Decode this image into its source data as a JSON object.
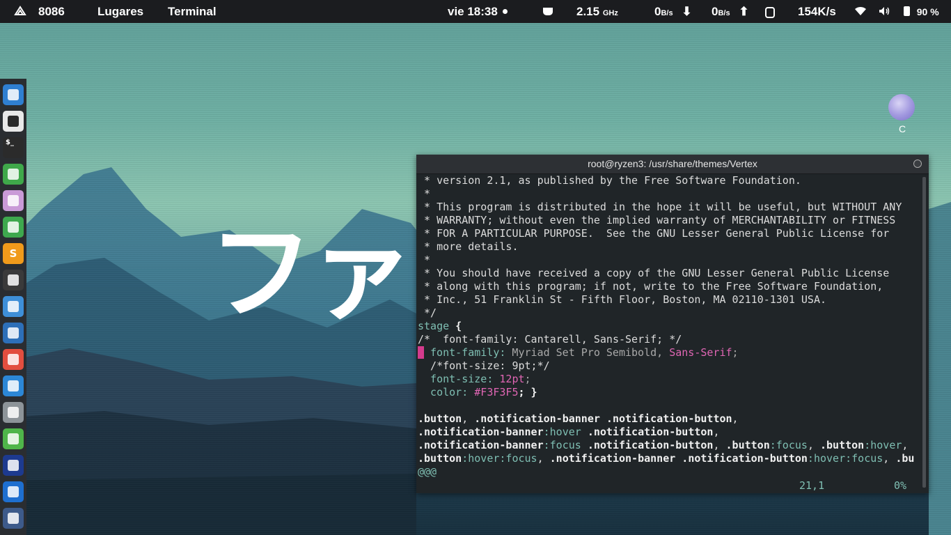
{
  "panel": {
    "activities_label": "8086",
    "places_label": "Lugares",
    "app_label": "Terminal",
    "clock": "vie 18:38",
    "cpu_freq_value": "2.15",
    "cpu_freq_unit": "GHz",
    "net_down_value": "0",
    "net_down_unit": "B/s",
    "net_up_value": "0",
    "net_up_unit": "B/s",
    "net_speed": "154K/s",
    "battery_percent": "90 %"
  },
  "dock": {
    "items": [
      {
        "name": "text-editor",
        "icon": "document-lines-icon",
        "color": "#2f7fd1"
      },
      {
        "name": "music-player",
        "icon": "music-note-icon",
        "color": "#e8e8e8"
      },
      {
        "name": "terminal",
        "icon": "terminal-icon",
        "glyph": "$_",
        "color": "#2b2b2b"
      },
      {
        "name": "chrome",
        "icon": "chrome-icon",
        "color": "#3fa84a"
      },
      {
        "name": "files",
        "icon": "folder-icon",
        "color": "#c99ad7"
      },
      {
        "name": "system-monitor",
        "icon": "monitor-icon",
        "color": "#3ea84e"
      },
      {
        "name": "sublime-text",
        "icon": "sublime-icon",
        "glyph": "S",
        "color": "#f09a1b"
      },
      {
        "name": "calculator",
        "icon": "calculator-icon",
        "color": "#3a3a3a"
      },
      {
        "name": "screenshot",
        "icon": "camera-icon",
        "color": "#3e8fd8"
      },
      {
        "name": "gnome-foot",
        "icon": "paw-icon",
        "color": "#2d6fb8"
      },
      {
        "name": "update-manager",
        "icon": "updown-arrows-icon",
        "color": "#e24e3f"
      },
      {
        "name": "activity-monitor",
        "icon": "waveform-icon",
        "color": "#2c87d6"
      },
      {
        "name": "disks",
        "icon": "database-icon",
        "color": "#8d9499"
      },
      {
        "name": "drawing",
        "icon": "brush-icon",
        "color": "#4fb54a"
      },
      {
        "name": "vlc",
        "icon": "cone-icon",
        "color": "#1d3a8f"
      },
      {
        "name": "teamviewer",
        "icon": "teamviewer-icon",
        "color": "#1e6fd0"
      },
      {
        "name": "vector-app",
        "icon": "pen-nib-icon",
        "color": "#3d5a8a"
      }
    ]
  },
  "desktop_icon": {
    "label": "C",
    "icon": "sphere-icon"
  },
  "wallpaper_text": "ファン",
  "terminal": {
    "title": "root@ryzen3: /usr/share/themes/Vertex",
    "status_position": "21,1",
    "status_percent": "0%",
    "lines": {
      "l1": " * version 2.1, as published by the Free Software Foundation.",
      "l2": " *",
      "l3": " * This program is distributed in the hope it will be useful, but WITHOUT ANY",
      "l4": " * WARRANTY; without even the implied warranty of MERCHANTABILITY or FITNESS",
      "l5": " * FOR A PARTICULAR PURPOSE.  See the GNU Lesser General Public License for",
      "l6": " * more details.",
      "l7": " *",
      "l8": " * You should have received a copy of the GNU Lesser General Public License",
      "l9": " * along with this program; if not, write to the Free Software Foundation,",
      "l10": " * Inc., 51 Franklin St - Fifth Floor, Boston, MA 02110-1301 USA.",
      "l11": " */",
      "l12_sel": "stage",
      "l12_brace": " {",
      "l13": "/*  font-family: Cantarell, Sans-Serif; */",
      "l14_prop": " font-family:",
      "l14_val": " Myriad Set Pro Semibold,",
      "l14_val2": " Sans-Serif",
      "l14_end": ";",
      "l15": "  /*font-size: 9pt;*/",
      "l16_prop": "  font-size:",
      "l16_val": " 12pt",
      "l16_end": ";",
      "l17_prop": "  color:",
      "l17_val": " #F3F3F5",
      "l17_end": "; }",
      "l19a": ".button",
      "l19b": ", ",
      "l19c": ".notification-banner .notification-button",
      "l19d": ",",
      "l20a": ".notification-banner",
      "l20b": ":hover",
      "l20c": " .notification-button",
      "l20d": ",",
      "l21a": ".notification-banner",
      "l21b": ":focus",
      "l21c": " .notification-button",
      "l21d": ", ",
      "l21e": ".button",
      "l21f": ":focus",
      "l21g": ", ",
      "l21h": ".button",
      "l21i": ":hover",
      "l21j": ",",
      "l22a": ".button",
      "l22b": ":hover:focus",
      "l22c": ", ",
      "l22d": ".notification-banner .notification-button",
      "l22e": ":hover:focus",
      "l22f": ", ",
      "l22g": ".bu",
      "l23": "@@@"
    }
  }
}
